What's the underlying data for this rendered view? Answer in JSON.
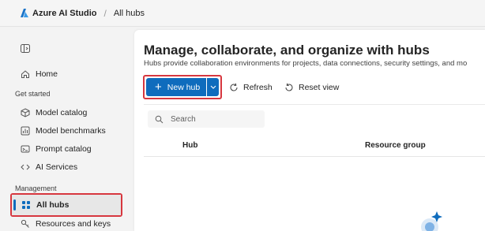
{
  "topbar": {
    "brand": "Azure AI Studio",
    "breadcrumb_current": "All hubs"
  },
  "sidebar": {
    "items": [
      {
        "label": "Home",
        "icon": "home-icon"
      },
      {
        "label": "Model catalog",
        "icon": "cube-icon"
      },
      {
        "label": "Model benchmarks",
        "icon": "benchmark-icon"
      },
      {
        "label": "Prompt catalog",
        "icon": "prompt-icon"
      },
      {
        "label": "AI Services",
        "icon": "ai-services-icon"
      },
      {
        "label": "All hubs",
        "icon": "hubs-icon",
        "selected": true
      },
      {
        "label": "Resources and keys",
        "icon": "key-icon"
      }
    ],
    "sections": {
      "get_started": "Get started",
      "management": "Management"
    }
  },
  "main": {
    "title": "Manage, collaborate, and organize with hubs",
    "subtitle": "Hubs provide collaboration environments for projects, data connections, security settings, and mo",
    "toolbar": {
      "new_hub": "New hub",
      "refresh": "Refresh",
      "reset_view": "Reset view"
    },
    "search_placeholder": "Search",
    "columns": [
      "Hub",
      "Resource group"
    ]
  },
  "colors": {
    "accent": "#0f6cbd",
    "highlight_border": "#d7373f"
  }
}
